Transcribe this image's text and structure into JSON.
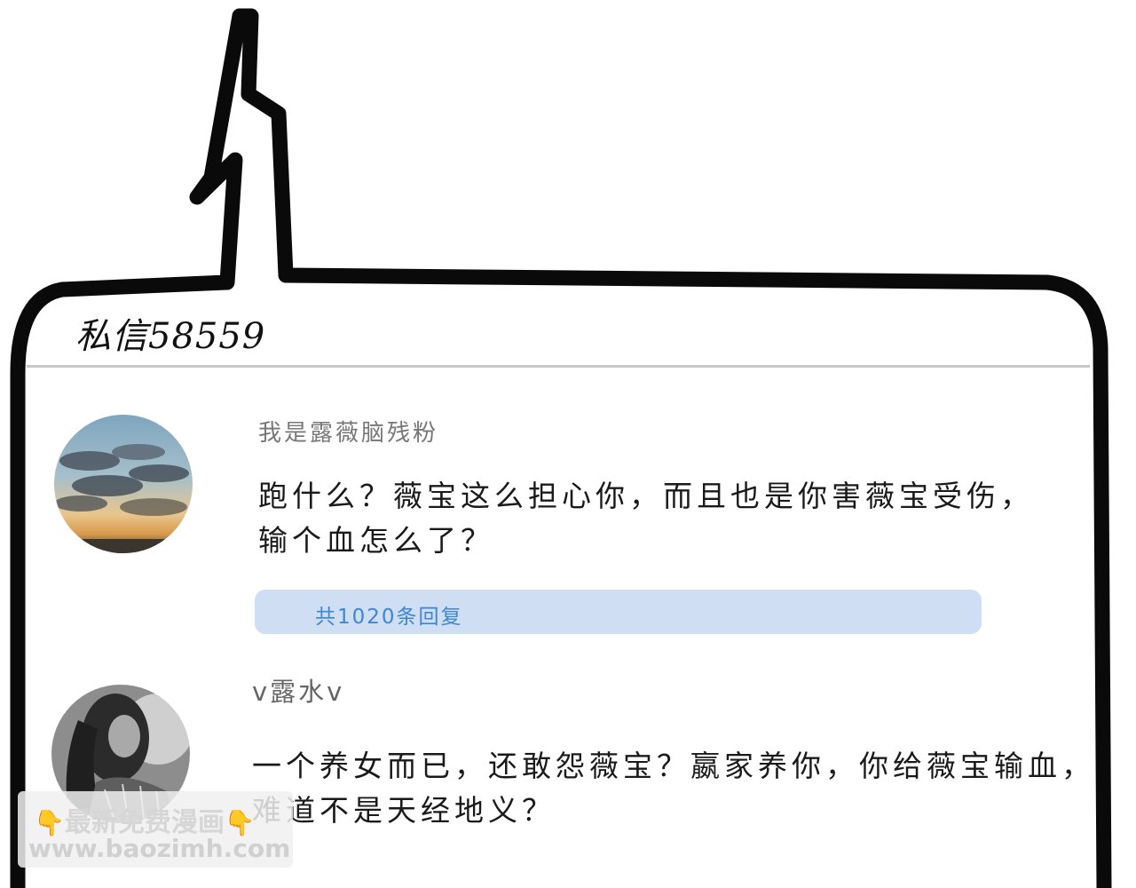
{
  "header": {
    "title": "私信58559"
  },
  "comments": [
    {
      "username": "我是露薇脑残粉",
      "lines": [
        "跑什么？薇宝这么担心你，而且也是你害薇宝受伤，",
        "输个血怎么了？"
      ],
      "reply_label": "共1020条回复"
    },
    {
      "username": "v露水v",
      "lines": [
        "一个养女而已，还敢怨薇宝？嬴家养你，你给薇宝输血，",
        "难道不是天经地义？"
      ]
    }
  ],
  "watermark": {
    "hand_left": "👇",
    "text": "最新免费漫画",
    "hand_right": "👇",
    "url": "www.baozimh.com"
  },
  "colors": {
    "frame": "#0a0a0a",
    "divider": "#c8c8c8",
    "reply_bg": "#cfdef3",
    "reply_text": "#3d86d6",
    "username": "#777777"
  },
  "icons": {
    "avatar_1": "sky-clouds-avatar",
    "avatar_2": "woman-portrait-avatar",
    "frame_tail": "lightning-speech-tail"
  }
}
